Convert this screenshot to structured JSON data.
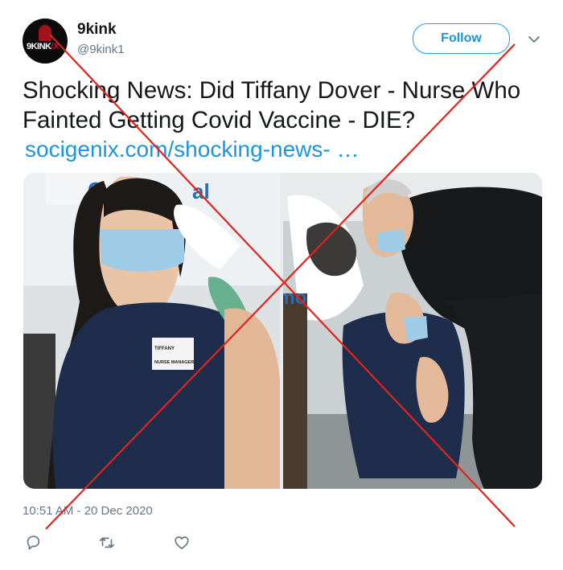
{
  "user": {
    "display_name": "9kink",
    "handle": "@9kink1",
    "avatar_logo_white": "9KINK",
    "avatar_logo_red": "/X"
  },
  "follow_button": {
    "label": "Follow"
  },
  "tweet": {
    "text": "Shocking News: Did Tiffany Dover - Nurse Who Fainted Getting Covid Vaccine - DIE?",
    "link": "socigenix.com/shocking-news-  …",
    "timestamp": "10:51 AM - 20 Dec 2020"
  },
  "media": {
    "left_photo_badge_name": "TIFFANY",
    "left_photo_badge_title": "NURSE MANAGER",
    "left_photo_sign_text": "C",
    "left_photo_sign_text_2": "al",
    "right_photo_sign_text": "emo"
  },
  "actions": [
    "reply-icon",
    "retweet-icon",
    "like-icon"
  ],
  "colors": {
    "link": "#1b95e0",
    "follow_border": "#1da1f2",
    "secondary_text": "#657786",
    "cross_lines": "#e0241b"
  }
}
